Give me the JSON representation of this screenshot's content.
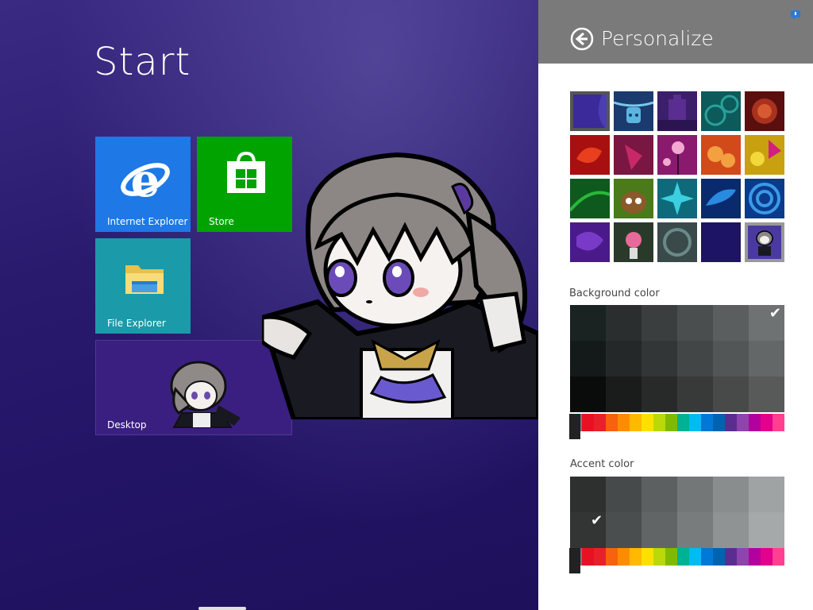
{
  "start": {
    "title": "Start"
  },
  "tiles": {
    "ie": {
      "label": "Internet Explorer",
      "color": "#1e78e6"
    },
    "store": {
      "label": "Store",
      "color": "#00a300"
    },
    "file_explorer": {
      "label": "File Explorer",
      "color": "#1b9aaa"
    },
    "desktop": {
      "label": "Desktop"
    }
  },
  "panel": {
    "title": "Personalize",
    "background_color_label": "Background color",
    "accent_color_label": "Accent color",
    "selected_pattern": "cartoon-character",
    "background_selected": "gray-6",
    "accent_selected": "dark-gray-1"
  },
  "colors": {
    "panel_header": "#7a7a7a",
    "hue_bar": [
      "#777777",
      "#e81123",
      "#e8202a",
      "#f7630c",
      "#ff8c00",
      "#ffb900",
      "#fce100",
      "#bad80a",
      "#7fba00",
      "#00b294",
      "#00bcf2",
      "#0078d7",
      "#0063b1",
      "#5c2d91",
      "#8e44ad",
      "#b4009e",
      "#e3008c",
      "#ff4091"
    ]
  }
}
